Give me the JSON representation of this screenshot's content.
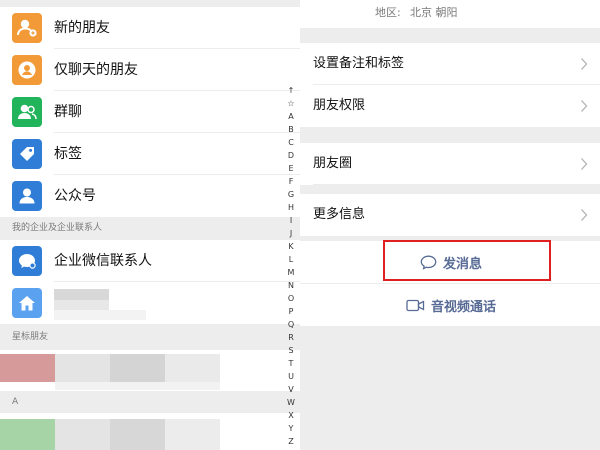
{
  "contacts": {
    "rows": [
      {
        "label": "新的朋友",
        "icon": "add-friend-icon",
        "color": "#f29a38"
      },
      {
        "label": "仅聊天的朋友",
        "icon": "chat-only-friend-icon",
        "color": "#f29a38"
      },
      {
        "label": "群聊",
        "icon": "group-chat-icon",
        "color": "#21b45b"
      },
      {
        "label": "标签",
        "icon": "tag-icon",
        "color": "#2f7dd6"
      },
      {
        "label": "公众号",
        "icon": "official-account-icon",
        "color": "#2f7dd6"
      }
    ],
    "enterprise_header": "我的企业及企业联系人",
    "enterprise_rows": [
      {
        "label": "企业微信联系人",
        "icon": "wecom-contacts-icon",
        "color": "#2f7dd6"
      },
      {
        "label": "",
        "icon": "home-icon",
        "color": "#5aa2f0"
      }
    ],
    "starred_header": "星标朋友",
    "letter_header": "A",
    "index": [
      "↑",
      "☆",
      "A",
      "B",
      "C",
      "D",
      "E",
      "F",
      "G",
      "H",
      "I",
      "J",
      "K",
      "L",
      "M",
      "N",
      "O",
      "P",
      "Q",
      "R",
      "S",
      "T",
      "U",
      "V",
      "W",
      "X",
      "Y",
      "Z"
    ]
  },
  "profile": {
    "region_label": "地区:",
    "region_value": "北京  朝阳",
    "menu_group1": [
      {
        "label": "设置备注和标签"
      },
      {
        "label": "朋友权限"
      }
    ],
    "menu_group2": [
      {
        "label": "朋友圈"
      },
      {
        "label": "更多信息"
      }
    ],
    "send_message": "发消息",
    "av_call": "音视频通话",
    "link_color": "#576b95",
    "highlight_color": "#e02020"
  }
}
